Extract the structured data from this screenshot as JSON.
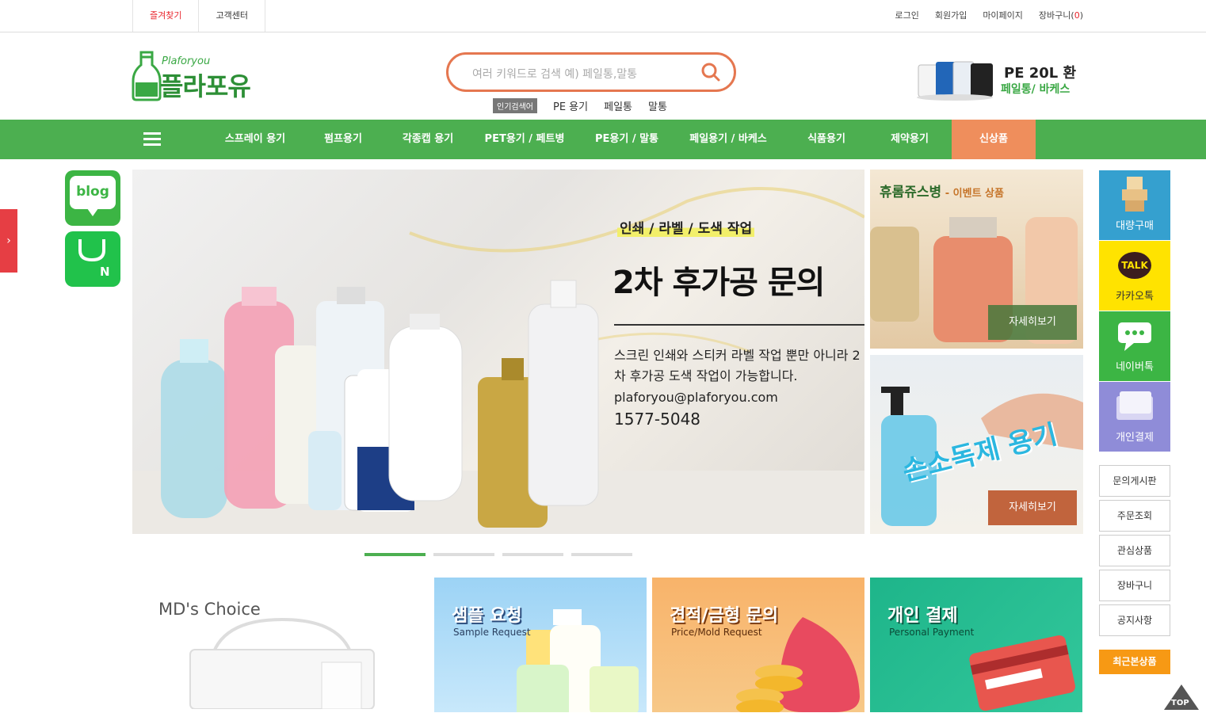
{
  "topbar": {
    "favorites": "즐겨찾기",
    "customer_center": "고객센터",
    "login": "로그인",
    "signup": "회원가입",
    "mypage": "마이페이지",
    "cart": "장바구니(",
    "cart_count": "0",
    "cart_close": ")"
  },
  "header": {
    "logo_en": "Plaforyou",
    "logo_kr": "플라포유",
    "search_placeholder": "여러 키워드로 검색 예) 페일통,말통",
    "popular_tag": "인기검색어",
    "popular": [
      "PE 용기",
      "페일통",
      "말통"
    ],
    "promo_title": "PE 20L 환",
    "promo_sub": "페일통/ 바케스"
  },
  "nav": {
    "items": [
      "스프레이 용기",
      "펌프용기",
      "각종캡 용기",
      "PET용기 / 페트병",
      "PE용기 / 말통",
      "페일용기 / 바케스",
      "식품용기",
      "제약용기",
      "신상품"
    ]
  },
  "side_left": {
    "blog": "blog",
    "band": "N",
    "tab_arrow": "›"
  },
  "hero": {
    "tag": "인쇄 / 라벨 / 도색 작업",
    "title": "2차 후가공 문의",
    "desc": "스크린 인쇄와 스티커 라벨 작업 뿐만 아니라 2차 후가공 도색 작업이 가능합니다.",
    "email": "plaforyou@plaforyou.com",
    "phone": "1577-5048",
    "slide_count": 4,
    "active_slide": 1
  },
  "cards": {
    "card1_title": "휴롬쥬스병",
    "card1_sub": " - 이벤트 상품",
    "card1_btn": "자세히보기",
    "card2_text": "손소독제 용기",
    "card2_btn": "자세히보기"
  },
  "quick_menu": {
    "bulk": "대량구매",
    "kakao": "카카오톡",
    "kakao_badge": "TALK",
    "naver": "네이버톡",
    "payment": "개인결제",
    "links": [
      "문의게시판",
      "주문조회",
      "관심상품",
      "장바구니",
      "공지사항"
    ],
    "recent": "최근본상품",
    "top": "TOP"
  },
  "bottom": {
    "md": "MD's Choice",
    "b1_title": "샘플 요청",
    "b1_sub": "Sample Request",
    "b2_title": "견적/금형 문의",
    "b2_sub": "Price/Mold Request",
    "b3_title": "개인 결제",
    "b3_sub": "Personal Payment"
  },
  "colors": {
    "primary_green": "#4caf50",
    "accent_orange": "#ef8e5c",
    "alert_red": "#e8262d"
  }
}
